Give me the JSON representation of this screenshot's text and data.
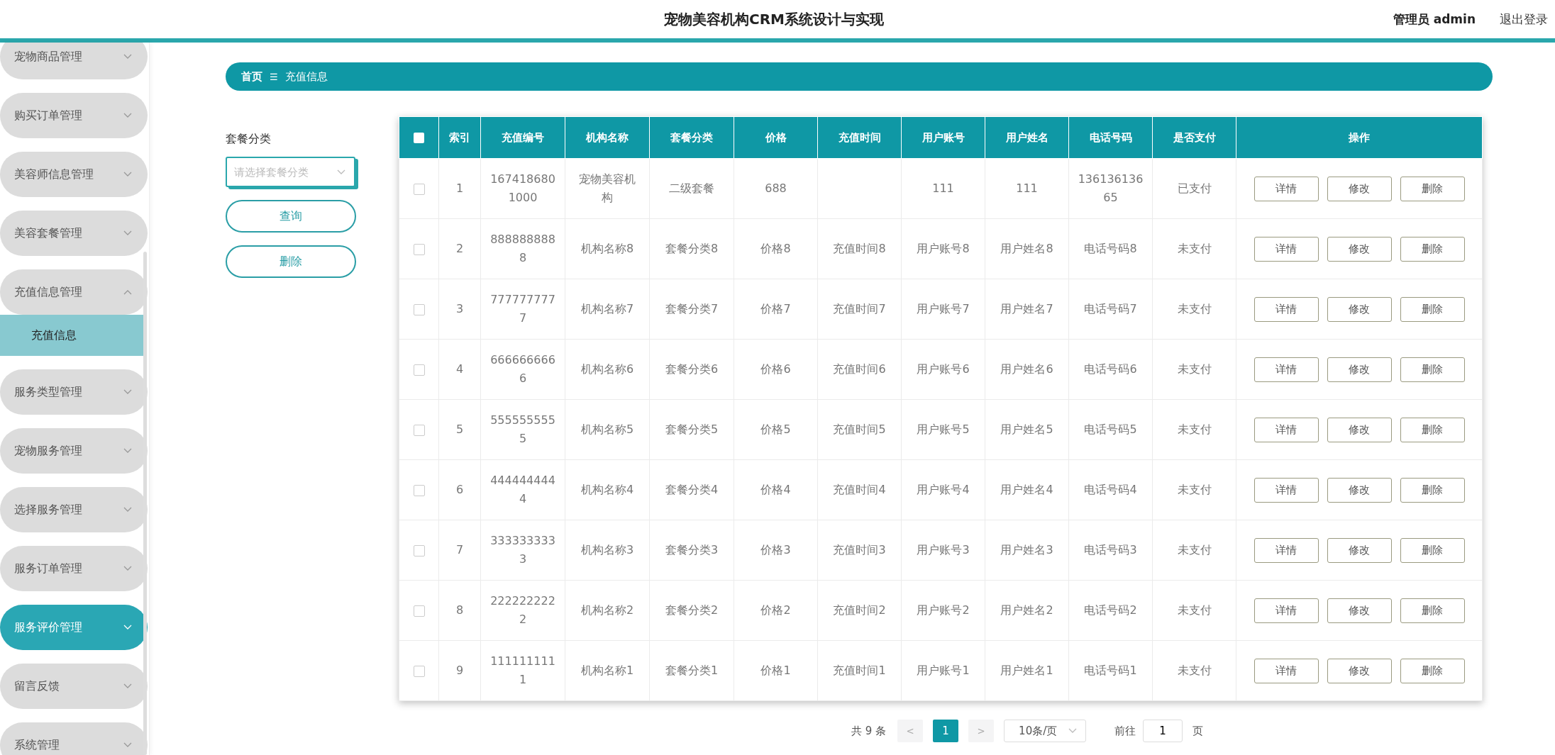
{
  "header": {
    "title": "宠物美容机构CRM系统设计与实现",
    "user": "管理员 admin",
    "logout": "退出登录"
  },
  "sidebar": {
    "items": [
      {
        "label": "宠物商品管理",
        "expanded": false,
        "hovered": false
      },
      {
        "label": "购买订单管理",
        "expanded": false,
        "hovered": false
      },
      {
        "label": "美容师信息管理",
        "expanded": false,
        "hovered": false
      },
      {
        "label": "美容套餐管理",
        "expanded": false,
        "hovered": false
      },
      {
        "label": "充值信息管理",
        "expanded": true,
        "hovered": false,
        "children": [
          {
            "label": "充值信息",
            "selected": true
          }
        ]
      },
      {
        "label": "服务类型管理",
        "expanded": false,
        "hovered": false
      },
      {
        "label": "宠物服务管理",
        "expanded": false,
        "hovered": false
      },
      {
        "label": "选择服务管理",
        "expanded": false,
        "hovered": false
      },
      {
        "label": "服务订单管理",
        "expanded": false,
        "hovered": false
      },
      {
        "label": "服务评价管理",
        "expanded": false,
        "hovered": true
      },
      {
        "label": "留言反馈",
        "expanded": false,
        "hovered": false
      },
      {
        "label": "系统管理",
        "expanded": false,
        "hovered": false
      }
    ]
  },
  "breadcrumb": {
    "home": "首页",
    "separator": "☰",
    "current": "充值信息"
  },
  "filter": {
    "label": "套餐分类",
    "placeholder": "请选择套餐分类",
    "buttons": [
      "查询",
      "删除"
    ]
  },
  "table": {
    "columns": [
      "索引",
      "充值编号",
      "机构名称",
      "套餐分类",
      "价格",
      "充值时间",
      "用户账号",
      "用户姓名",
      "电话号码",
      "是否支付",
      "操作"
    ],
    "header_checked": false,
    "rows": [
      {
        "checked": false,
        "cells": [
          "1",
          "1674186801000",
          "宠物美容机构",
          "二级套餐",
          "688",
          null,
          "111",
          "111",
          "13613613665",
          "已支付"
        ],
        "actions": [
          "详情",
          "修改",
          "删除"
        ]
      },
      {
        "checked": false,
        "cells": [
          "2",
          "8888888888",
          "机构名称8",
          "套餐分类8",
          "价格8",
          "充值时间8",
          "用户账号8",
          "用户姓名8",
          "电话号码8",
          "未支付"
        ],
        "actions": [
          "详情",
          "修改",
          "删除"
        ]
      },
      {
        "checked": false,
        "cells": [
          "3",
          "7777777777",
          "机构名称7",
          "套餐分类7",
          "价格7",
          "充值时间7",
          "用户账号7",
          "用户姓名7",
          "电话号码7",
          "未支付"
        ],
        "actions": [
          "详情",
          "修改",
          "删除"
        ]
      },
      {
        "checked": false,
        "cells": [
          "4",
          "6666666666",
          "机构名称6",
          "套餐分类6",
          "价格6",
          "充值时间6",
          "用户账号6",
          "用户姓名6",
          "电话号码6",
          "未支付"
        ],
        "actions": [
          "详情",
          "修改",
          "删除"
        ]
      },
      {
        "checked": false,
        "cells": [
          "5",
          "5555555555",
          "机构名称5",
          "套餐分类5",
          "价格5",
          "充值时间5",
          "用户账号5",
          "用户姓名5",
          "电话号码5",
          "未支付"
        ],
        "actions": [
          "详情",
          "修改",
          "删除"
        ]
      },
      {
        "checked": false,
        "cells": [
          "6",
          "4444444444",
          "机构名称4",
          "套餐分类4",
          "价格4",
          "充值时间4",
          "用户账号4",
          "用户姓名4",
          "电话号码4",
          "未支付"
        ],
        "actions": [
          "详情",
          "修改",
          "删除"
        ]
      },
      {
        "checked": false,
        "cells": [
          "7",
          "3333333333",
          "机构名称3",
          "套餐分类3",
          "价格3",
          "充值时间3",
          "用户账号3",
          "用户姓名3",
          "电话号码3",
          "未支付"
        ],
        "actions": [
          "详情",
          "修改",
          "删除"
        ]
      },
      {
        "checked": false,
        "cells": [
          "8",
          "2222222222",
          "机构名称2",
          "套餐分类2",
          "价格2",
          "充值时间2",
          "用户账号2",
          "用户姓名2",
          "电话号码2",
          "未支付"
        ],
        "actions": [
          "详情",
          "修改",
          "删除"
        ]
      },
      {
        "checked": false,
        "cells": [
          "9",
          "1111111111",
          "机构名称1",
          "套餐分类1",
          "价格1",
          "充值时间1",
          "用户账号1",
          "用户姓名1",
          "电话号码1",
          "未支付"
        ],
        "actions": [
          "详情",
          "修改",
          "删除"
        ]
      }
    ]
  },
  "pagination": {
    "total": "共 9 条",
    "prev": "<",
    "pages": [
      {
        "label": "1",
        "selected": true
      }
    ],
    "next": ">",
    "page_size": "10条/页",
    "goto_label": "前往",
    "goto_value": "1",
    "goto_suffix": "页"
  }
}
